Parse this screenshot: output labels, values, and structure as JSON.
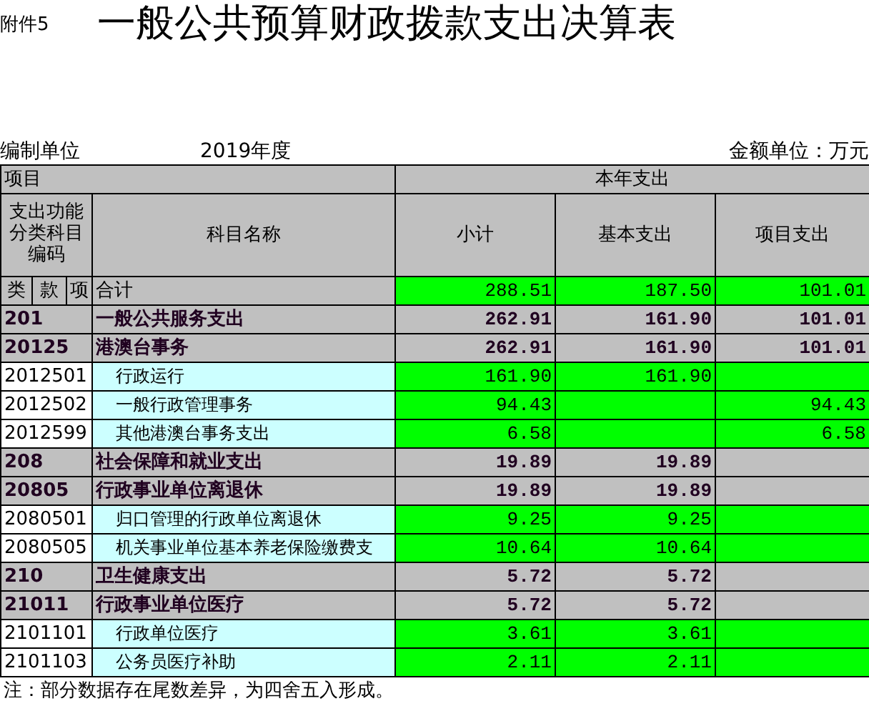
{
  "attachment": "附件5",
  "title": "一般公共预算财政拨款支出决算表",
  "unit_label": "编制单位",
  "year": "2019年度",
  "amount_unit": "金额单位：万元",
  "header": {
    "item": "项目",
    "current_year": "本年支出",
    "code": "支出功能分类科目编码",
    "name": "科目名称",
    "columns": [
      "小计",
      "基本支出",
      "项目支出"
    ],
    "code_parts": [
      "类",
      "款",
      "项"
    ],
    "total_label": "合计"
  },
  "total_values": [
    "288.51",
    "187.50",
    "101.01"
  ],
  "rows": [
    {
      "kind": "category",
      "code": "201",
      "name": "一般公共服务支出",
      "subtotal": "262.91",
      "basic": "161.90",
      "project": "101.01"
    },
    {
      "kind": "category",
      "code": "20125",
      "name": "港澳台事务",
      "subtotal": "262.91",
      "basic": "161.90",
      "project": "101.01"
    },
    {
      "kind": "item",
      "code": "2012501",
      "name": "行政运行",
      "subtotal": "161.90",
      "basic": "161.90"
    },
    {
      "kind": "item",
      "code": "2012502",
      "name": "一般行政管理事务",
      "subtotal": "94.43",
      "project": "94.43"
    },
    {
      "kind": "item",
      "code": "2012599",
      "name": "其他港澳台事务支出",
      "subtotal": "6.58",
      "project": "6.58"
    },
    {
      "kind": "category",
      "code": "208",
      "name": "社会保障和就业支出",
      "subtotal": "19.89",
      "basic": "19.89"
    },
    {
      "kind": "category",
      "code": "20805",
      "name": "行政事业单位离退休",
      "subtotal": "19.89",
      "basic": "19.89"
    },
    {
      "kind": "item",
      "code": "2080501",
      "name": "归口管理的行政单位离退休",
      "subtotal": "9.25",
      "basic": "9.25"
    },
    {
      "kind": "item",
      "code": "2080505",
      "name": "机关事业单位基本养老保险缴费支",
      "subtotal": "10.64",
      "basic": "10.64"
    },
    {
      "kind": "category",
      "code": "210",
      "name": "卫生健康支出",
      "subtotal": "5.72",
      "basic": "5.72"
    },
    {
      "kind": "category",
      "code": "21011",
      "name": "行政事业单位医疗",
      "subtotal": "5.72",
      "basic": "5.72"
    },
    {
      "kind": "item",
      "code": "2101101",
      "name": "行政单位医疗",
      "subtotal": "3.61",
      "basic": "3.61"
    },
    {
      "kind": "item",
      "code": "2101103",
      "name": "公务员医疗补助",
      "subtotal": "2.11",
      "basic": "2.11"
    }
  ],
  "note": "注：部分数据存在尾数差异，为四舍五入形成。"
}
